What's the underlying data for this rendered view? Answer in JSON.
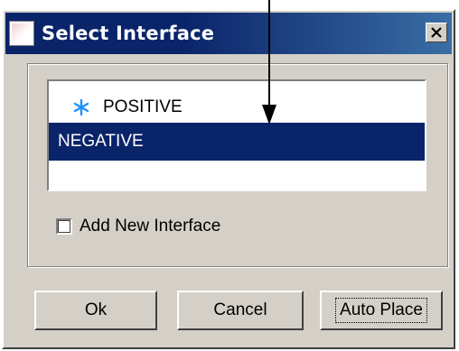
{
  "window": {
    "title": "Select Interface",
    "close_label": "X"
  },
  "list": {
    "items": [
      {
        "label": "POSITIVE",
        "marker": "asterisk-icon",
        "selected": false
      },
      {
        "label": "NEGATIVE",
        "selected": true
      }
    ]
  },
  "checkbox": {
    "label": "Add New Interface",
    "checked": false
  },
  "buttons": {
    "ok": "Ok",
    "cancel": "Cancel",
    "auto_place": "Auto Place"
  },
  "colors": {
    "title_bar": "#0a246a",
    "selection": "#0a246a",
    "face": "#d4d0c8",
    "marker": "#1e90ff"
  }
}
